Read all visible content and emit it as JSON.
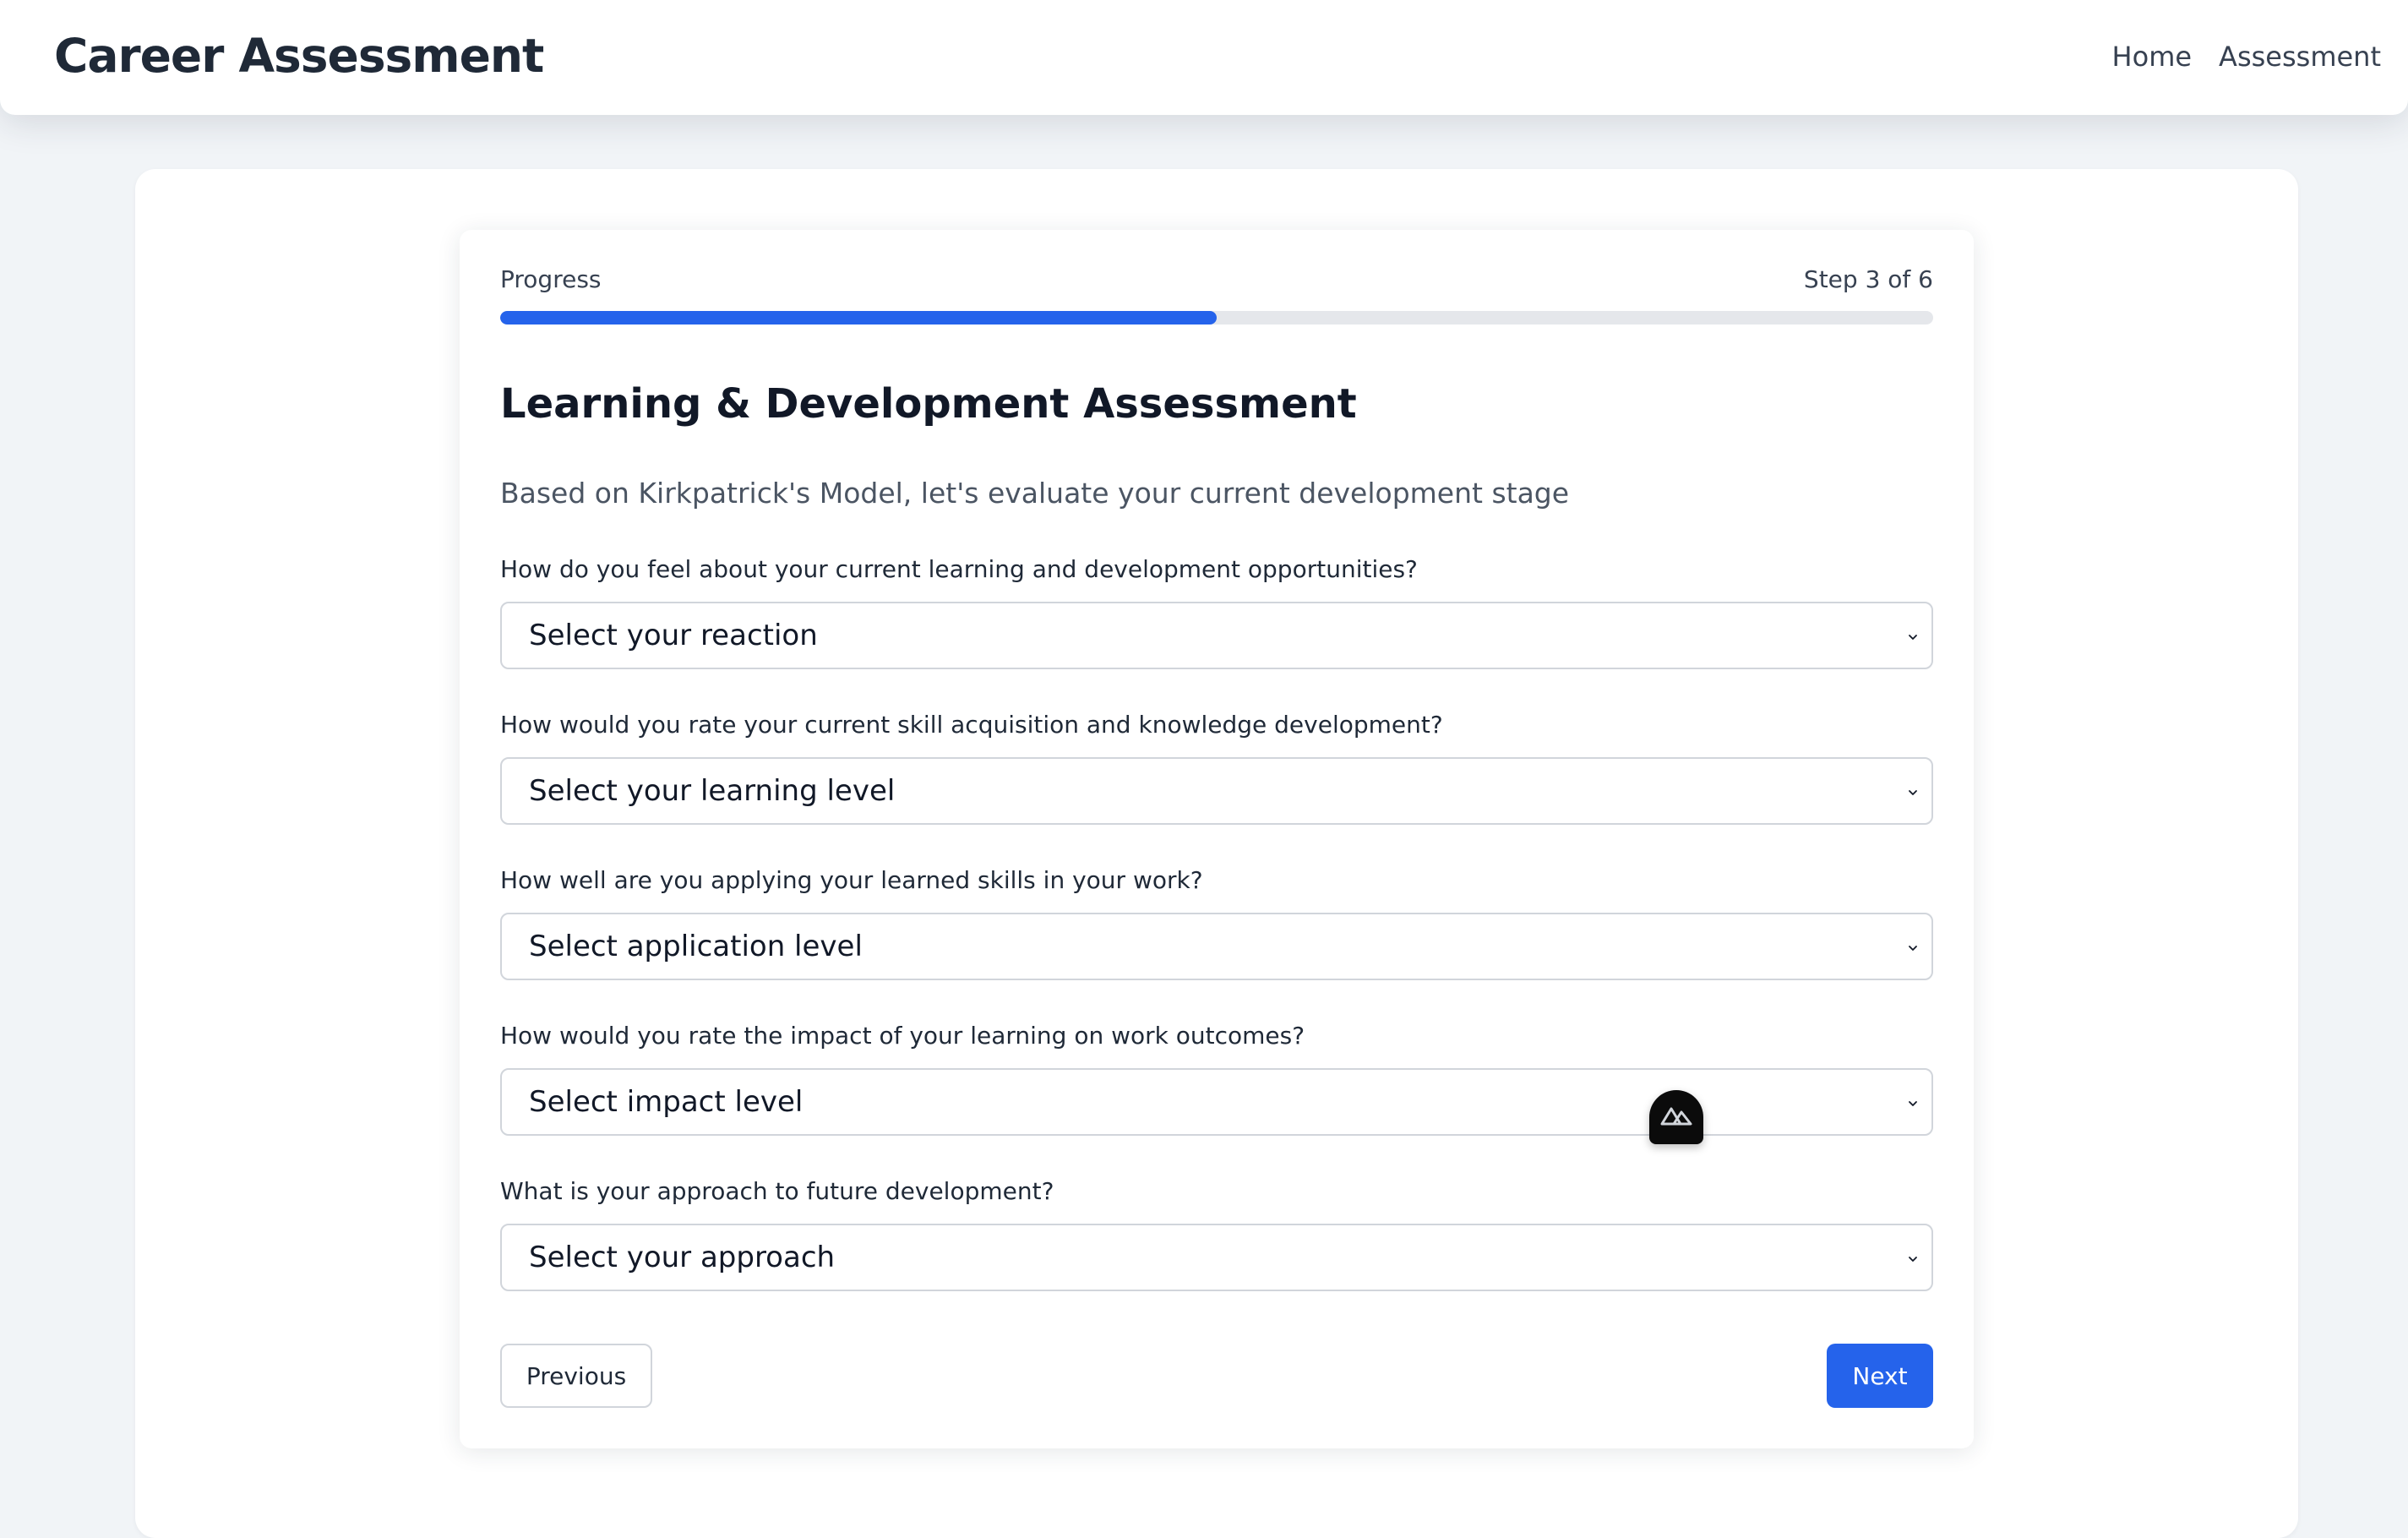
{
  "header": {
    "title": "Career Assessment",
    "nav": {
      "home": "Home",
      "assessment": "Assessment"
    }
  },
  "progress": {
    "label": "Progress",
    "step_text": "Step 3 of 6",
    "fraction": 0.5
  },
  "form": {
    "title": "Learning & Development Assessment",
    "subtitle": "Based on Kirkpatrick's Model, let's evaluate your current development stage",
    "questions": [
      {
        "label": "How do you feel about your current learning and development opportunities?",
        "selected": "Select your reaction"
      },
      {
        "label": "How would you rate your current skill acquisition and knowledge development?",
        "selected": "Select your learning level"
      },
      {
        "label": "How well are you applying your learned skills in your work?",
        "selected": "Select application level"
      },
      {
        "label": "How would you rate the impact of your learning on work outcomes?",
        "selected": "Select impact level"
      },
      {
        "label": "What is your approach to future development?",
        "selected": "Select your approach"
      }
    ],
    "buttons": {
      "previous": "Previous",
      "next": "Next"
    }
  },
  "icons": {
    "select_chevron": "chevron-down-icon",
    "dev_badge": "mountain-logo-icon"
  },
  "colors": {
    "accent": "#2563eb",
    "track": "#e5e7eb",
    "background": "#f1f4f7"
  }
}
